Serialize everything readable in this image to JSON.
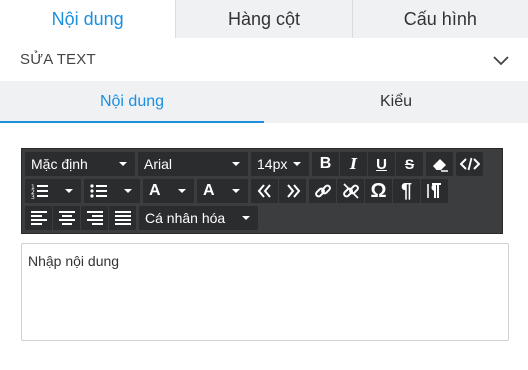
{
  "top_tabs": [
    {
      "label": "Nội dung",
      "active": true
    },
    {
      "label": "Hàng cột",
      "active": false
    },
    {
      "label": "Cấu hình",
      "active": false
    }
  ],
  "section": {
    "title": "SỬA TEXT",
    "icon": "chevron-down-icon"
  },
  "sub_tabs": [
    {
      "label": "Nội dung",
      "active": true
    },
    {
      "label": "Kiểu",
      "active": false
    }
  ],
  "toolbar": {
    "format_select": "Mặc định",
    "font_select": "Arial",
    "size_select": "14px",
    "bold_label": "B",
    "italic_label": "I",
    "underline_label": "U",
    "strike_label": "S",
    "text_color_label": "A",
    "bg_color_label": "A",
    "omega_label": "Ω",
    "pilcrow_label": "¶",
    "custom_select": "Cá nhân hóa"
  },
  "editor": {
    "placeholder": "Nhập nội dung"
  },
  "colors": {
    "accent": "#1a8fe0",
    "toolbar_bg": "#3c3d3f",
    "button_bg": "#2b2c2e",
    "tab_bg": "#f0f1f3"
  }
}
